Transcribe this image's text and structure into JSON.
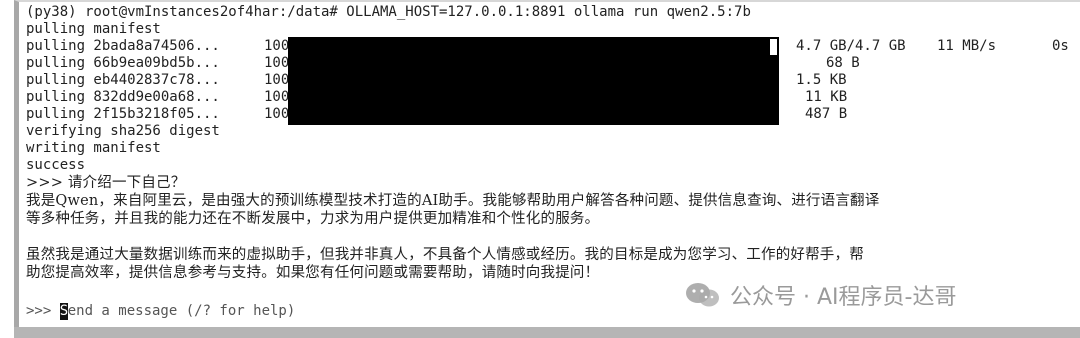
{
  "terminal": {
    "command_line": "(py38) root@vmInstances2of4har:/data# OLLAMA_HOST=127.0.0.1:8891 ollama run qwen2.5:7b",
    "pulling_manifest": "pulling manifest",
    "layers": [
      {
        "label": "pulling 2bada8a74506...",
        "percent": "100%",
        "progress": 1.0,
        "size": "4.7 GB/4.7 GB",
        "speed": "11 MB/s",
        "eta": "0s"
      },
      {
        "label": "pulling 66b9ea09bd5b...",
        "percent": "100%",
        "progress": 1.0,
        "size": "68 B"
      },
      {
        "label": "pulling eb4402837c78...",
        "percent": "100%",
        "progress": 1.0,
        "size": "1.5 KB"
      },
      {
        "label": "pulling 832dd9e00a68...",
        "percent": "100%",
        "progress": 1.0,
        "size": "11 KB"
      },
      {
        "label": "pulling 2f15b3218f05...",
        "percent": "100%",
        "progress": 1.0,
        "size": "487 B"
      }
    ],
    "verifying": "verifying sha256 digest",
    "writing": "writing manifest",
    "success": "success",
    "user_prompt": ">>> 请介绍一下自己？",
    "response_p1_l1": "我是Qwen，来自阿里云，是由强大的预训练模型技术打造的AI助手。我能够帮助用户解答各种问题、提供信息查询、进行语言翻译",
    "response_p1_l2": "等多种任务，并且我的能力还在不断发展中，力求为用户提供更加精准和个性化的服务。",
    "response_p2_l1": "虽然我是通过大量数据训练而来的虚拟助手，但我并非真人，不具备个人情感或经历。我的目标是成为您学习、工作的好帮手，帮",
    "response_p2_l2": "助您提高效率，提供信息参考与支持。如果您有任何问题或需要帮助，请随时向我提问！",
    "input_prompt": ">>> ",
    "input_caret_char": "S",
    "input_placeholder": "end a message (/? for help)"
  },
  "watermark": {
    "text": "公众号 · AI程序员-达哥",
    "icon": "wechat-icon"
  }
}
